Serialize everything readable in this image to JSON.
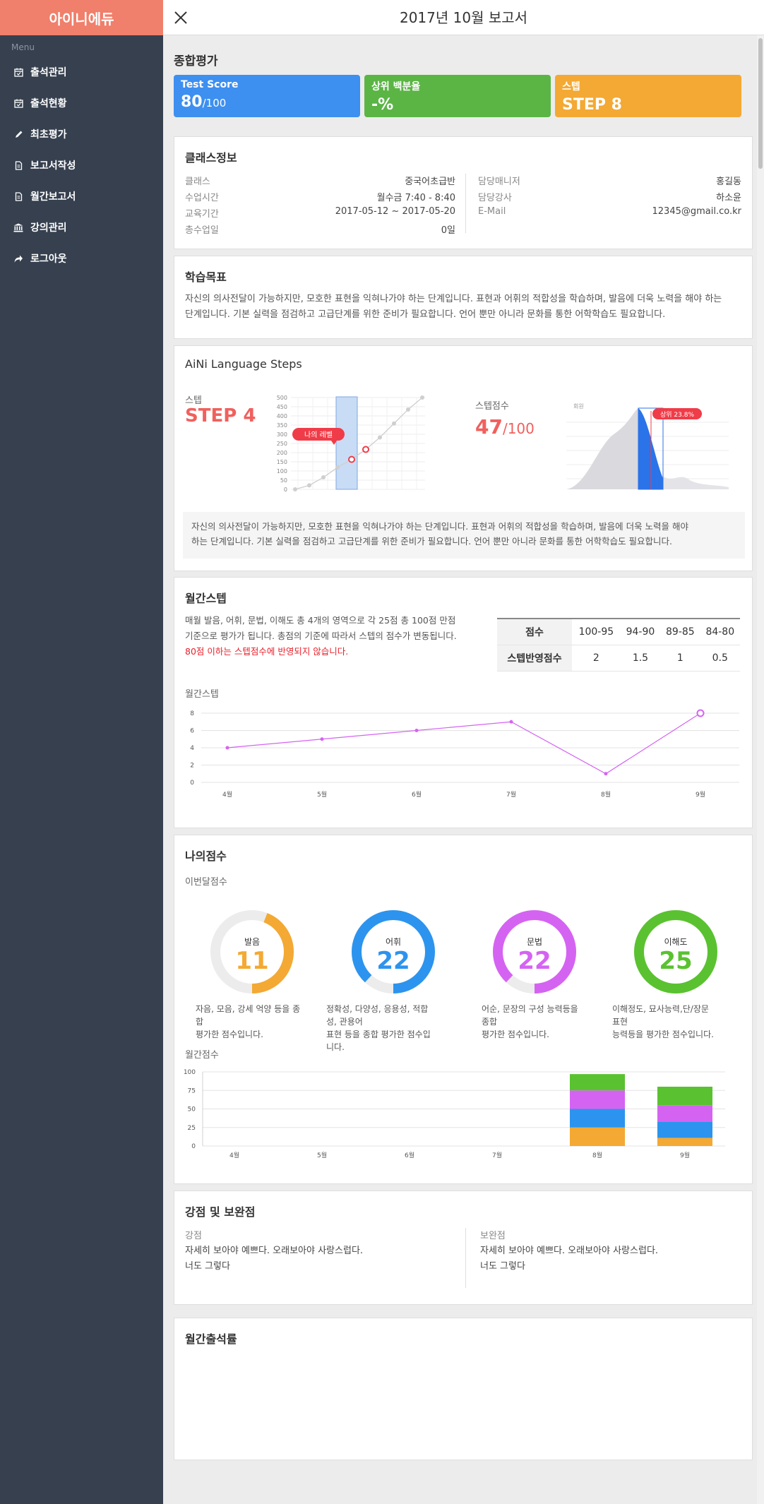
{
  "sidebar": {
    "brand": "아이니에듀",
    "menu_caption": "Menu",
    "items": [
      {
        "label": "출석관리",
        "icon": "calendar-check-icon"
      },
      {
        "label": "출석현황",
        "icon": "calendar-check-icon"
      },
      {
        "label": "최초평가",
        "icon": "pencil-icon"
      },
      {
        "label": "보고서작성",
        "icon": "document-icon"
      },
      {
        "label": "월간보고서",
        "icon": "document-icon"
      },
      {
        "label": "강의관리",
        "icon": "institution-icon"
      },
      {
        "label": "로그아웃",
        "icon": "share-arrow-icon"
      }
    ]
  },
  "header": {
    "title": "2017년 10월 보고서",
    "close_icon": "close-icon"
  },
  "summary": {
    "title": "종합평가",
    "tiles": [
      {
        "label": "Test Score",
        "value": "80",
        "suffix": "/100",
        "color": "#3d8ff0"
      },
      {
        "label": "상위 백분율",
        "value": "-%",
        "suffix": "",
        "color": "#5bb545"
      },
      {
        "label": "스텝",
        "value": "STEP 8",
        "suffix": "",
        "color": "#f3a933"
      }
    ]
  },
  "class_info": {
    "title": "클래스정보",
    "left": [
      {
        "label": "클래스",
        "value": "중국어초급반"
      },
      {
        "label": "수업시간",
        "value": "월수금 7:40 - 8:40"
      },
      {
        "label": "교육기간",
        "value": "2017-05-12 ~ 2017-05-20"
      },
      {
        "label": "총수업일",
        "value": "0일"
      }
    ],
    "right": [
      {
        "label": "담당매니저",
        "value": "홍길동"
      },
      {
        "label": "담당강사",
        "value": "하소윤"
      },
      {
        "label": "E-Mail",
        "value": "12345@gmail.co.kr"
      }
    ]
  },
  "goal": {
    "title": "학습목표",
    "line1": "자신의 의사전달이 가능하지만, 모호한 표현을 익혀나가야 하는 단계입니다. 표현과 어휘의 적합성을 학습하며, 발음에 더욱 노력을 해야 하는",
    "line2": "단계입니다. 기본 실력을 점검하고 고급단계를 위한 준비가 필요합니다. 언어 뿐만 아니라 문화를 통한 어학학습도 필요합니다."
  },
  "language_steps": {
    "title": "AiNi Language Steps",
    "step_label": "스텝",
    "step_value": "STEP 4",
    "score_label": "스텝점수",
    "score_value": "47",
    "score_suffix": "/100",
    "level_tag": "나의 레벨",
    "rank_tag": "상위 23.8%",
    "dist_axis_label": "회원",
    "desc_line1": "자신의 의사전달이 가능하지만, 모호한 표현을 익혀나가야 하는 단계입니다. 표현과 어휘의 적합성을 학습하며, 발음에 더욱 노력을 해야",
    "desc_line2": "하는 단계입니다. 기본 실력을 점검하고 고급단계를 위한 준비가 필요합니다. 언어 뿐만 아니라 문화를 통한 어학학습도 필요합니다."
  },
  "monthly_step": {
    "title": "월간스텝",
    "desc_line1": "매월 발음, 어휘, 문법, 이해도 총 4개의 영역으로 각 25점 총 100점 만점",
    "desc_line2": "기준으로 평가가 됩니다. 총점의 기준에 따라서 스텝의 점수가 변동됩니다.",
    "warning": "80점 이하는 스텝점수에 반영되지 않습니다.",
    "table": {
      "header_row": [
        "점수",
        "100-95",
        "94-90",
        "89-85",
        "84-80"
      ],
      "value_row": [
        "스텝반영점수",
        "2",
        "1.5",
        "1",
        "0.5"
      ]
    },
    "chart_label": "월간스텝"
  },
  "my_score": {
    "title": "나의점수",
    "this_month_label": "이번달점수",
    "monthly_label": "월간점수",
    "donuts": [
      {
        "name": "발음",
        "value": "11",
        "score": 11,
        "color": "#f3a933",
        "desc_line1": "자음, 모음, 강세 억양 등을 종합",
        "desc_line2": "평가한 점수입니다."
      },
      {
        "name": "어휘",
        "value": "22",
        "score": 22,
        "color": "#2c94ee",
        "desc_line1": "정확성, 다양성, 응용성, 적합성, 관용어",
        "desc_line2": "표현 등을 종합 평가한 점수입니다."
      },
      {
        "name": "문법",
        "value": "22",
        "score": 22,
        "color": "#d563f2",
        "desc_line1": "어순, 문장의 구성 능력등을 종합",
        "desc_line2": "평가한 점수입니다."
      },
      {
        "name": "이해도",
        "value": "25",
        "score": 25,
        "color": "#5ac230",
        "desc_line1": "이해정도, 묘사능력,단/장문 표현",
        "desc_line2": "능력등을 평가한 점수입니다."
      }
    ]
  },
  "strengths": {
    "title": "강점 및 보완점",
    "left_label": "강점",
    "left_line1": "자세히 보아야 예쁘다.  오래보아야 사랑스럽다.",
    "left_line2": "너도 그렇다",
    "right_label": "보완점",
    "right_line1": "자세히 보아야 예쁘다.  오래보아야 사랑스럽다.",
    "right_line2": "너도 그렇다"
  },
  "attendance": {
    "title": "월간출석률"
  },
  "chart_data": [
    {
      "type": "line",
      "title": "",
      "categories": [
        "4월",
        "5월",
        "6월",
        "7월",
        "8월",
        "9월"
      ],
      "values": [
        4,
        5,
        6,
        7,
        1,
        8
      ],
      "ylim": [
        0,
        8
      ],
      "yticks": [
        0,
        2,
        4,
        6,
        8
      ],
      "color": "#d563f2",
      "grid": true
    },
    {
      "type": "bar",
      "stacked": true,
      "categories": [
        "4월",
        "5월",
        "6월",
        "7월",
        "8월",
        "9월"
      ],
      "ylim": [
        0,
        100
      ],
      "yticks": [
        0,
        25,
        50,
        75,
        100
      ],
      "series": [
        {
          "values": [
            0,
            0,
            0,
            0,
            25,
            11
          ],
          "color": "#f3a933"
        },
        {
          "values": [
            0,
            0,
            0,
            0,
            25,
            22
          ],
          "color": "#2c94ee"
        },
        {
          "values": [
            0,
            0,
            0,
            0,
            25,
            22
          ],
          "color": "#d563f2"
        },
        {
          "values": [
            0,
            0,
            0,
            0,
            22,
            25
          ],
          "color": "#5ac230"
        }
      ],
      "grid": true
    },
    {
      "type": "line",
      "categories": [
        "0",
        "50",
        "100",
        "150",
        "200",
        "250",
        "300",
        "350",
        "400",
        "450",
        "500"
      ],
      "values": [
        0,
        50,
        100,
        150,
        200,
        250,
        300,
        350,
        400,
        450,
        500
      ],
      "ylim": [
        0,
        500
      ],
      "yticks": [
        0,
        50,
        100,
        150,
        200,
        250,
        300,
        350,
        400,
        450,
        500
      ],
      "highlight_points": [
        [
          3,
          150
        ],
        [
          4,
          200
        ]
      ],
      "color": "#cccccc",
      "grid": true
    }
  ]
}
